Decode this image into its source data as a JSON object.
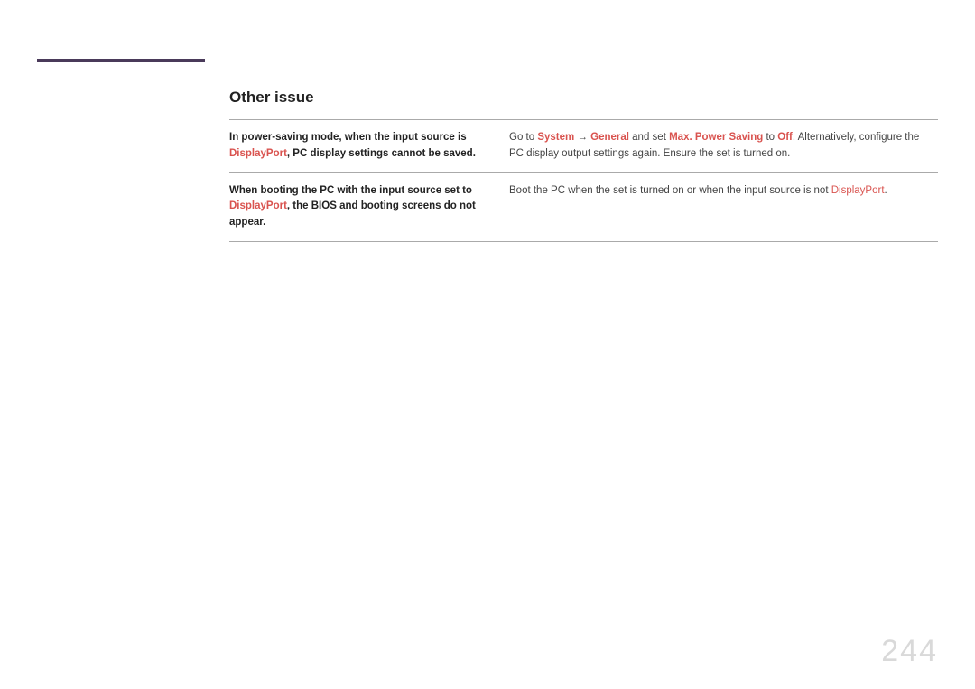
{
  "section_title": "Other issue",
  "page_number": "244",
  "rows": [
    {
      "left_pre": "In power-saving mode, when the input source is ",
      "left_hl1": "DisplayPort",
      "left_mid": ", PC display settings cannot be saved.",
      "left_hl2": "",
      "left_post": "",
      "right_pre": "Go to ",
      "right_hl1": "System",
      "right_arrow": " → ",
      "right_hl2": "General",
      "right_mid": " and set ",
      "right_hl3": "Max. Power Saving",
      "right_mid2": " to ",
      "right_hl4": "Off",
      "right_post": ". Alternatively, configure the PC display output settings again. Ensure the set is turned on."
    },
    {
      "left_pre": "When booting the PC with the input source set to ",
      "left_hl1": "DisplayPort",
      "left_mid": ", the BIOS and booting screens do not appear.",
      "left_hl2": "",
      "left_post": "",
      "right_pre": "Boot the PC when the set is turned on or when the input source is not ",
      "right_hl1": "DisplayPort",
      "right_arrow": "",
      "right_hl2": "",
      "right_mid": "",
      "right_hl3": "",
      "right_mid2": "",
      "right_hl4": "",
      "right_post": "."
    }
  ]
}
